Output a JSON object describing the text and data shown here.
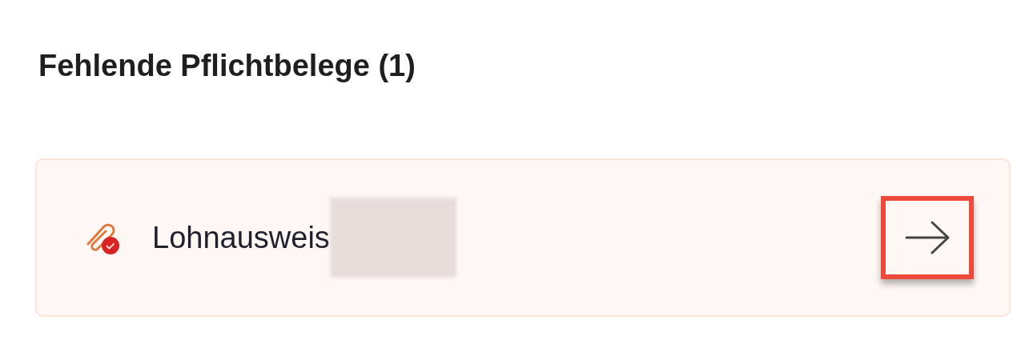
{
  "section": {
    "title": "Fehlende Pflichtbelege (1)"
  },
  "documents": [
    {
      "label": "Lohnausweis",
      "highlighted": true
    }
  ]
}
